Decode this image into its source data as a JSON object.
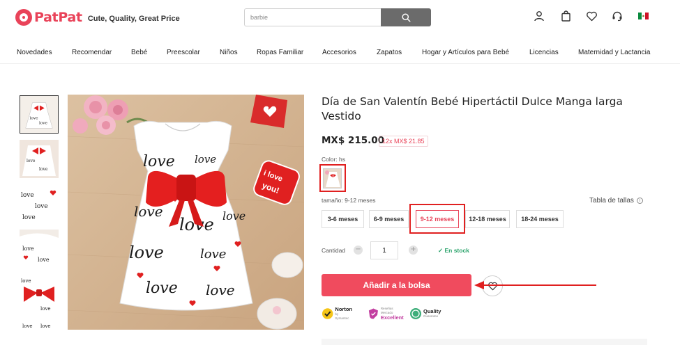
{
  "brand": {
    "name": "PatPat",
    "tagline": "Cute, Quality, Great Price",
    "color": "#e94359"
  },
  "search": {
    "value": "barbie",
    "button_icon": "search-icon"
  },
  "header_icons": [
    "user-icon",
    "shopping-bag-icon",
    "heart-icon",
    "headset-icon",
    "mexico-flag-icon"
  ],
  "nav": {
    "items": [
      "Novedades",
      "Recomendar",
      "Bebé",
      "Preescolar",
      "Niños",
      "Ropas Familiar",
      "Accesorios",
      "Zapatos",
      "Hogar y Artículos para Bebé",
      "Licencias",
      "Maternidad y Lactancia"
    ]
  },
  "gallery": {
    "thumbnail_count": 6,
    "selected_index": 0
  },
  "product": {
    "title": "Día de San Valentín Bebé Hipertáctil Dulce Manga larga Vestido",
    "price": "MX$ 215.00",
    "installment": "12x MX$ 21.85",
    "color_label": "Color: hs",
    "size_label": "tamaño: 9-12 meses",
    "size_chart_label": "Tabla de tallas",
    "sizes": [
      "3-6 meses",
      "6-9 meses",
      "9-12 meses",
      "12-18 meses",
      "18-24 meses"
    ],
    "selected_size": "9-12 meses",
    "quantity_label": "Cantidad",
    "quantity": "1",
    "stock_status": "En stock",
    "add_to_bag": "Añadir a la bolsa"
  },
  "image_text": {
    "sticker": "i love you!",
    "print_word": "love"
  },
  "badges": [
    {
      "main": "Norton",
      "sub": "by Symantec"
    },
    {
      "main": "Excellent",
      "sub": "Reseñas Mercado"
    },
    {
      "main": "Quality",
      "sub": "Guarantee"
    }
  ],
  "colors": {
    "accent": "#f04b5e",
    "annotation": "#e02020",
    "stock": "#2aa36b"
  }
}
